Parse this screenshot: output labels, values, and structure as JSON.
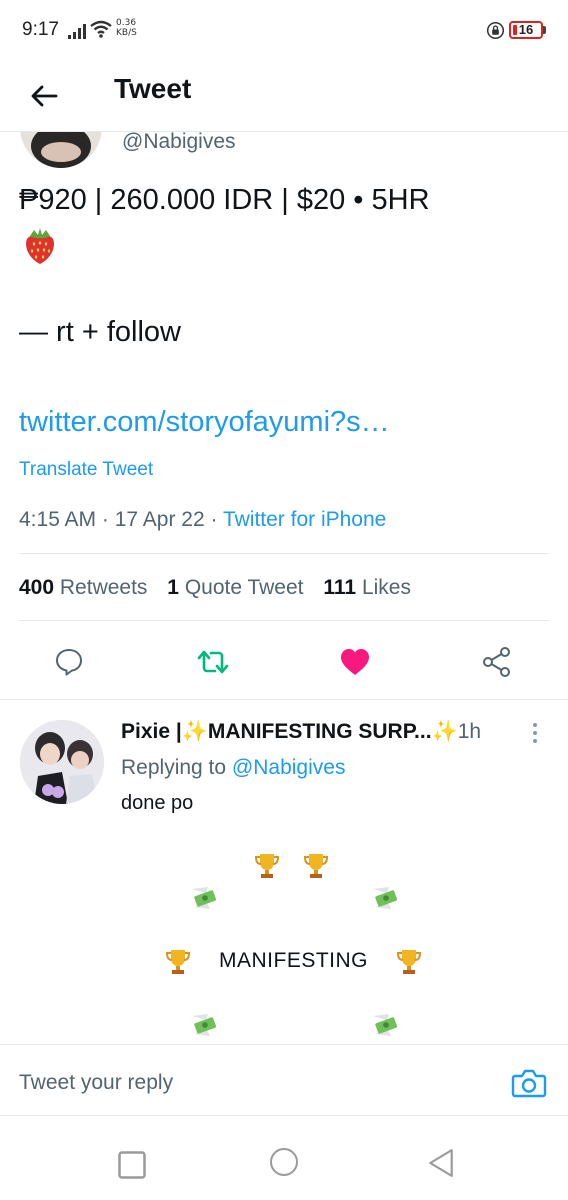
{
  "status_bar": {
    "time": "9:17",
    "net_speed_value": "0.36",
    "net_speed_unit": "KB/S",
    "battery_level": "16"
  },
  "header": {
    "title": "Tweet",
    "back_icon": "arrow-left-icon"
  },
  "tweet": {
    "author_handle": "@Nabigives",
    "body_line1": "₱920 | 260.000 IDR | $20 • 5HR",
    "emoji": "strawberry",
    "cta": "— rt + follow",
    "link": "twitter.com/storyofayumi?s…",
    "translate": "Translate Tweet",
    "time": "4:15 AM",
    "date": "17 Apr 22",
    "source": "Twitter for iPhone",
    "stats": {
      "retweets_count": "400",
      "retweets_label": "Retweets",
      "quotes_count": "1",
      "quotes_label": "Quote Tweet",
      "likes_count": "111",
      "likes_label": "Likes"
    }
  },
  "actions": {
    "reply_icon": "speech-bubble-icon",
    "retweet_icon": "retweet-icon",
    "like_icon": "heart-icon",
    "share_icon": "share-icon",
    "retweet_color": "#00ba7c",
    "like_color": "#f91880"
  },
  "reply": {
    "name": "Pixie |✨MANIFESTING SURP...✨",
    "time": "1h",
    "replying_prefix": "Replying to",
    "replying_handle": "@Nabigives",
    "text": "done po",
    "manifesting": "MANIFESTING"
  },
  "compose": {
    "placeholder": "Tweet your reply",
    "camera_icon": "camera-icon"
  },
  "nav": {
    "recents_icon": "square-icon",
    "home_icon": "circle-icon",
    "back_icon": "triangle-back-icon"
  },
  "colors": {
    "accent": "#1d9bf0",
    "text_primary": "#0f1419",
    "text_secondary": "#536471",
    "battery_low": "#dd2222"
  }
}
